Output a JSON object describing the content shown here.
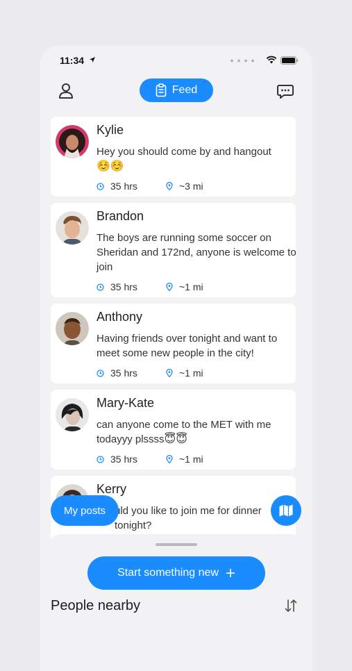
{
  "status_bar": {
    "time": "11:34"
  },
  "nav": {
    "feed_label": "Feed"
  },
  "posts": [
    {
      "name": "Kylie",
      "message": "Hey you should come by and hangout",
      "emoji": "☺️☺️",
      "time": "35 hrs",
      "distance": "~3 mi"
    },
    {
      "name": "Brandon",
      "message": "The boys are running some soccer on Sheridan and 172nd, anyone is welcome to join",
      "emoji": "",
      "time": "35 hrs",
      "distance": "~1 mi"
    },
    {
      "name": "Anthony",
      "message": "Having friends over tonight and want to meet some new people in the city!",
      "emoji": "",
      "time": "35 hrs",
      "distance": "~1 mi"
    },
    {
      "name": "Mary-Kate",
      "message": "can anyone come to the MET with me todayyy plssss",
      "emoji": "😇😇",
      "time": "35 hrs",
      "distance": "~1 mi"
    },
    {
      "name": "Kerry",
      "message": "uld you like to join me for dinner tonight?",
      "emoji": "",
      "time": "",
      "distance": ""
    }
  ],
  "buttons": {
    "my_posts": "My posts",
    "start_new": "Start something new"
  },
  "sheet": {
    "title": "People nearby"
  },
  "colors": {
    "accent": "#1a8cff",
    "background": "#f2f2f4"
  }
}
